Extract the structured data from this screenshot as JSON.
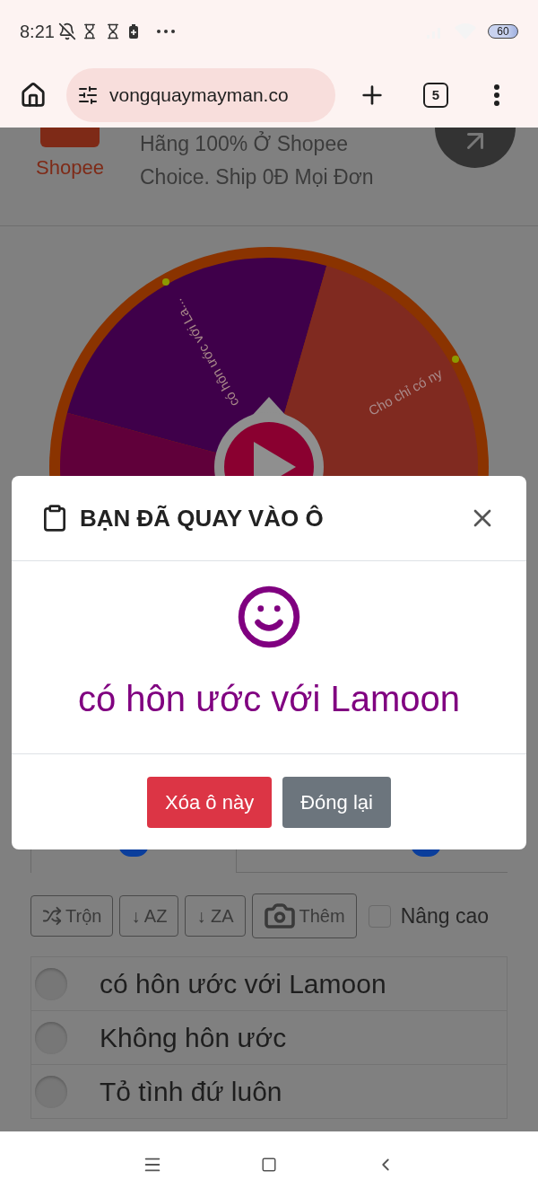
{
  "status_bar": {
    "time": "8:21",
    "battery": "60"
  },
  "browser": {
    "url": "vongquaymayman.co",
    "tab_count": "5"
  },
  "ad": {
    "logo": "Shopee",
    "text": "Hãng 100% Ở Shopee Choice. Ship 0Đ Mọi Đơn"
  },
  "wheel": {
    "segments": [
      {
        "label": "có hôn ước với La...",
        "color": "#3f004a"
      },
      {
        "label": "Cho chỉ có ny",
        "color": "#802a20"
      },
      {
        "color": "#60003a"
      }
    ]
  },
  "toolbar": {
    "buttons": [
      {
        "kind": "shuffle",
        "label": "Trộn"
      },
      {
        "kind": "text",
        "label": "↓ AZ"
      },
      {
        "kind": "text",
        "label": "↓ ZA"
      },
      {
        "kind": "camera",
        "label": "Thêm"
      }
    ],
    "advanced": {
      "label": "Nâng cao",
      "checked": false
    }
  },
  "entries": [
    {
      "text": "có hôn ước với Lamoon",
      "selected": false
    },
    {
      "text": "Không hôn ước",
      "selected": false
    },
    {
      "text": "Tỏ tình đứ luôn",
      "selected": false
    }
  ],
  "dialog": {
    "title": "BẠN ĐÃ QUAY VÀO Ô",
    "result": "có hôn ước với Lamoon",
    "buttons": [
      {
        "kind": "danger",
        "label": "Xóa ô này"
      },
      {
        "kind": "secondary",
        "label": "Đóng lại"
      }
    ]
  }
}
